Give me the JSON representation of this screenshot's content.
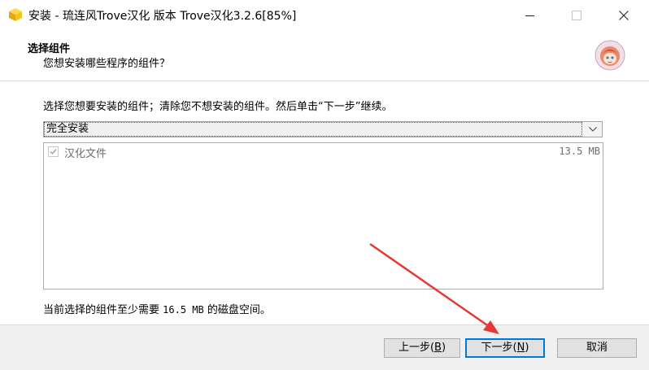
{
  "window": {
    "title": "安装 - 琉连风Trove汉化 版本 Trove汉化3.2.6[85%]"
  },
  "header": {
    "title": "选择组件",
    "subtitle": "您想安装哪些程序的组件？"
  },
  "body": {
    "instruction": "选择您想要安装的组件；清除您不想安装的组件。然后单击“下一步”继续。",
    "install_type": "完全安装",
    "components": [
      {
        "label": "汉化文件",
        "size": "13.5 MB",
        "checked": true
      }
    ],
    "space_prefix": "当前选择的组件至少需要",
    "space_value": "16.5 MB",
    "space_suffix": "的磁盘空间。"
  },
  "buttons": {
    "back": {
      "label": "上一步(",
      "key": "B",
      "end": ")"
    },
    "next": {
      "label": "下一步(",
      "key": "N",
      "end": ")"
    },
    "cancel": "取消"
  },
  "colors": {
    "focus_border": "#0078d7",
    "arrow": "#e53935",
    "app_icon": "#f5c518"
  }
}
